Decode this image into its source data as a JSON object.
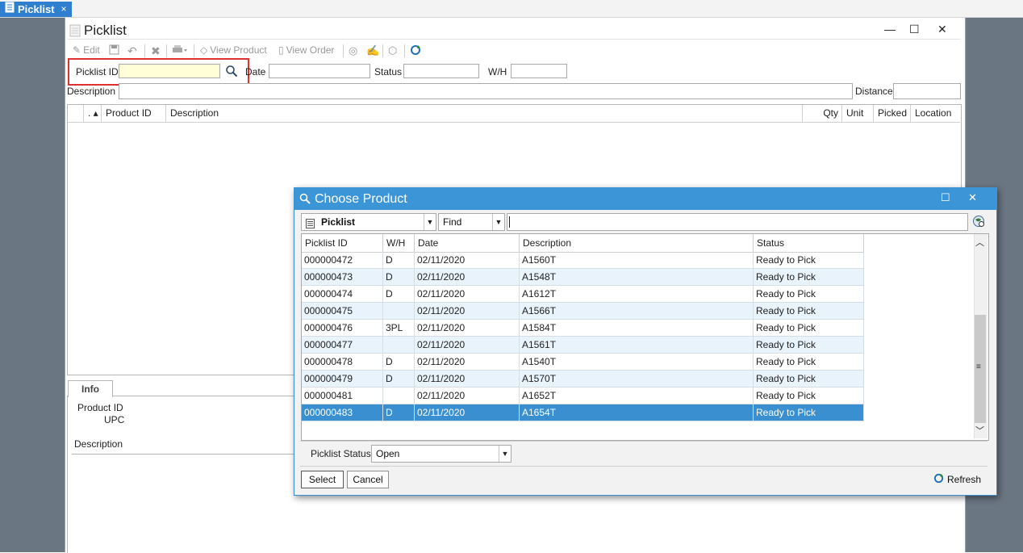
{
  "tab": {
    "label": "Picklist",
    "close": "×"
  },
  "form": {
    "title": "Picklist",
    "window_buttons": {
      "minimize": "—",
      "maximize": "☐",
      "close": "✕"
    },
    "toolbar": {
      "edit": "Edit",
      "view_product": "View Product",
      "view_order": "View Order"
    },
    "fields": {
      "picklist_id_label": "Picklist ID",
      "picklist_id_value": "",
      "date_label": "Date",
      "date_value": "",
      "status_label": "Status",
      "status_value": "",
      "wh_label": "W/H",
      "wh_value": "",
      "description_label": "Description",
      "description_value": "",
      "distance_label": "Distance",
      "distance_value": ""
    },
    "grid_headers": {
      "sort": ". ▴",
      "product_id": "Product ID",
      "description": "Description",
      "qty": "Qty",
      "unit": "Unit",
      "picked": "Picked",
      "location": "Location"
    },
    "info": {
      "tab_label": "Info",
      "product_id_label": "Product ID",
      "upc_label": "UPC",
      "description_label": "Description"
    }
  },
  "dialog": {
    "title": "Choose Product",
    "window_buttons": {
      "maximize": "☐",
      "close": "✕"
    },
    "source_combo": "Picklist",
    "find_combo": "Find",
    "search_value": "",
    "headers": {
      "picklist_id": "Picklist ID",
      "wh": "W/H",
      "date": "Date",
      "description": "Description",
      "status": "Status"
    },
    "rows": [
      {
        "id": "000000472",
        "wh": "D",
        "date": "02/11/2020",
        "desc": "A1560T",
        "status": "Ready to Pick"
      },
      {
        "id": "000000473",
        "wh": "D",
        "date": "02/11/2020",
        "desc": "A1548T",
        "status": "Ready to Pick"
      },
      {
        "id": "000000474",
        "wh": "D",
        "date": "02/11/2020",
        "desc": "A1612T",
        "status": "Ready to Pick"
      },
      {
        "id": "000000475",
        "wh": "",
        "date": "02/11/2020",
        "desc": "A1566T",
        "status": "Ready to Pick"
      },
      {
        "id": "000000476",
        "wh": "3PL",
        "date": "02/11/2020",
        "desc": "A1584T",
        "status": "Ready to Pick"
      },
      {
        "id": "000000477",
        "wh": "",
        "date": "02/11/2020",
        "desc": "A1561T",
        "status": "Ready to Pick"
      },
      {
        "id": "000000478",
        "wh": "D",
        "date": "02/11/2020",
        "desc": "A1540T",
        "status": "Ready to Pick"
      },
      {
        "id": "000000479",
        "wh": "D",
        "date": "02/11/2020",
        "desc": "A1570T",
        "status": "Ready to Pick"
      },
      {
        "id": "000000481",
        "wh": "",
        "date": "02/11/2020",
        "desc": "A1652T",
        "status": "Ready to Pick"
      },
      {
        "id": "000000483",
        "wh": "D",
        "date": "02/11/2020",
        "desc": "A1654T",
        "status": "Ready to Pick"
      }
    ],
    "selected_row_index": 9,
    "picklist_status_label": "Picklist Status",
    "picklist_status_value": "Open",
    "select_button": "Select",
    "cancel_button": "Cancel",
    "refresh_button": "Refresh"
  },
  "colors": {
    "accent": "#3c95d6",
    "selection": "#3a8fd0",
    "highlight_box": "#e03030",
    "input_highlight": "#fffed6"
  }
}
